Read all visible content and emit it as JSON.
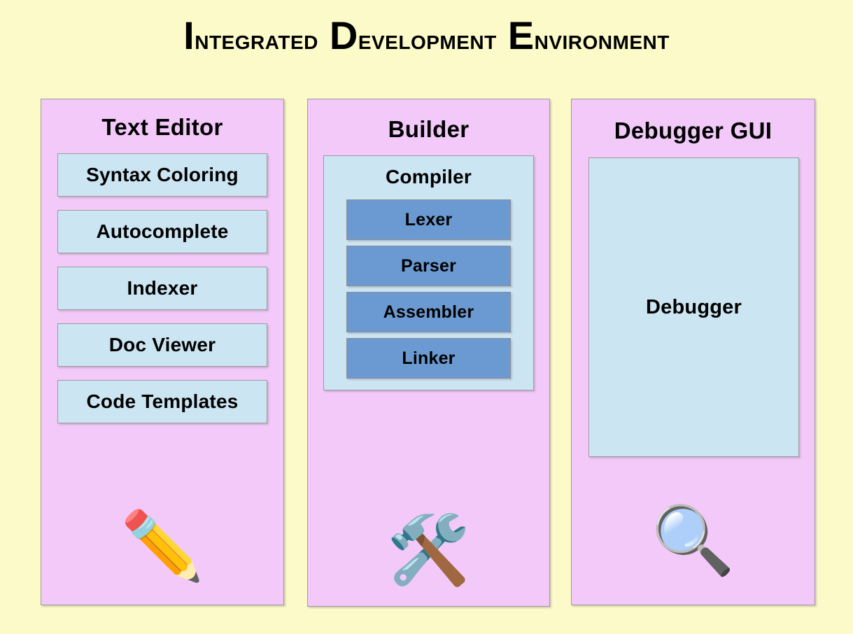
{
  "title": {
    "words": [
      {
        "cap": "I",
        "rest": "ntegrated"
      },
      {
        "cap": "D",
        "rest": "evelopment"
      },
      {
        "cap": "E",
        "rest": "nvironment"
      }
    ],
    "full_text": "Integrated Development Environment"
  },
  "colors": {
    "background": "#fcfac8",
    "panel": "#f2c9f9",
    "feature_box": "#cce5f2",
    "stage_box": "#6a9ad1",
    "border": "#9e9a9e",
    "text": "#000000"
  },
  "columns": [
    {
      "id": "text-editor",
      "title": "Text Editor",
      "features": [
        "Syntax Coloring",
        "Autocomplete",
        "Indexer",
        "Doc Viewer",
        "Code Templates"
      ],
      "emoji": "✏️",
      "emoji_name": "pencil-icon"
    },
    {
      "id": "builder",
      "title": "Builder",
      "subgroup": {
        "title": "Compiler",
        "stages": [
          "Lexer",
          "Parser",
          "Assembler",
          "Linker"
        ]
      },
      "emoji": "🛠️",
      "emoji_name": "tools-icon"
    },
    {
      "id": "debugger",
      "title": "Debugger GUI",
      "bigbox_label": "Debugger",
      "emoji": "🔍",
      "emoji_name": "magnifying-glass-icon"
    }
  ]
}
